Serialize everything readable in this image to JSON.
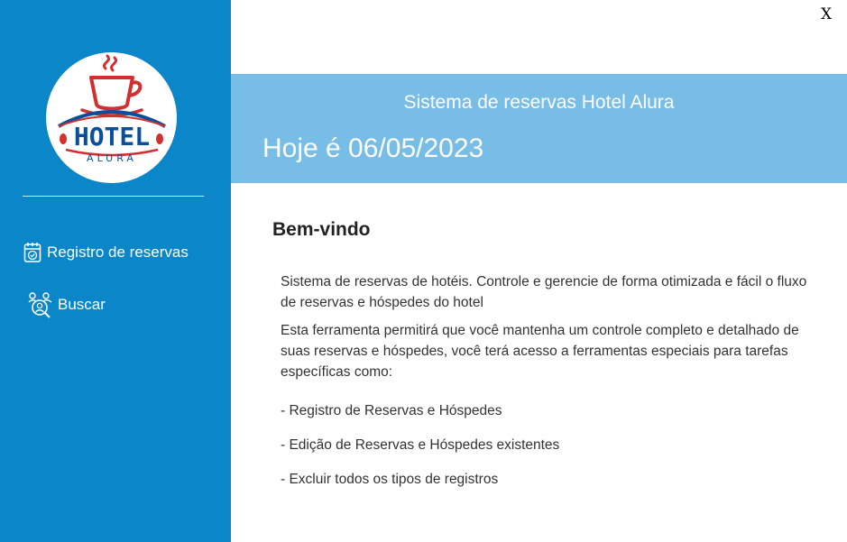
{
  "window": {
    "close_label": "X"
  },
  "sidebar": {
    "logo": {
      "name": "hotel-alura-logo",
      "title": "HOTEL",
      "subtitle": "ALURA",
      "colors": {
        "red": "#d32f2f",
        "blue": "#0b4f9c"
      }
    },
    "items": [
      {
        "label": "Registro de reservas",
        "icon": "calendar-check-icon"
      },
      {
        "label": "Buscar",
        "icon": "user-search-icon"
      }
    ],
    "background": "#0b86c8"
  },
  "header": {
    "title": "Sistema de reservas Hotel Alura",
    "date": "Hoje é 06/05/2023",
    "background": "#78bde6"
  },
  "main": {
    "welcome": "Bem-vindo",
    "paragraphs": [
      "Sistema de reservas de hotéis. Controle e gerencie de forma otimizada e fácil o fluxo de reservas e hóspedes do hotel",
      "Esta ferramenta permitirá que você mantenha um controle completo e detalhado de suas reservas e hóspedes, você terá acesso a ferramentas especiais para tarefas específicas como:"
    ],
    "bullets": [
      "- Registro de Reservas e Hóspedes",
      "- Edição de Reservas e Hóspedes existentes",
      "- Excluir todos os tipos de registros"
    ]
  }
}
